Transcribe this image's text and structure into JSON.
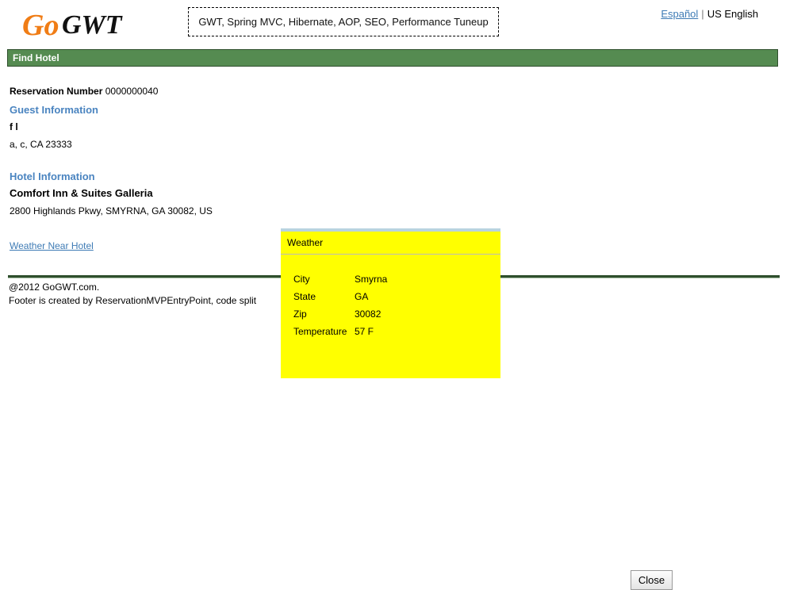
{
  "header": {
    "logo_text": "GoGWT",
    "tagline": "GWT, Spring MVC, Hibernate, AOP, SEO, Performance Tuneup",
    "languages": {
      "espanol": "Español",
      "separator": "|",
      "english": "US English"
    }
  },
  "find_hotel": {
    "title": "Find Hotel"
  },
  "reservation": {
    "label": "Reservation Number",
    "number": "0000000040"
  },
  "guest": {
    "title": "Guest Information",
    "name": "f l",
    "address": "a, c, CA 23333"
  },
  "hotel": {
    "title": "Hotel Information",
    "name": "Comfort Inn & Suites Galleria",
    "address": "2800 Highlands Pkwy, SMYRNA, GA 30082, US",
    "weather_link": "Weather Near Hotel"
  },
  "footer": {
    "line1": "@2012 GoGWT.com.",
    "line2": "Footer is created by ReservationMVPEntryPoint, code split"
  },
  "weather_popup": {
    "caption": "Weather",
    "rows": [
      {
        "label": "City",
        "value": "Smyrna"
      },
      {
        "label": "State",
        "value": "GA"
      },
      {
        "label": "Zip",
        "value": "30082"
      },
      {
        "label": "Temperature",
        "value": "57 F"
      }
    ],
    "close_label": "Close"
  },
  "colors": {
    "header_bar": "#558b51",
    "section_title": "#4a84c0",
    "link": "#3e7bb5",
    "popup_bg": "#ffff00",
    "logo_orange": "#f07d16"
  }
}
